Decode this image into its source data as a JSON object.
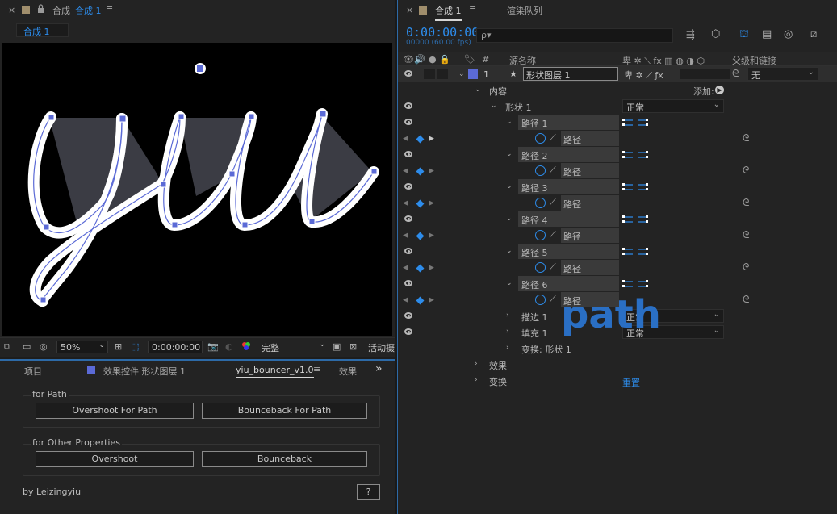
{
  "comp_panel": {
    "close": "×",
    "lock_icon": "lock-icon",
    "title_prefix": "合成",
    "title": "合成 1",
    "menu": "≡",
    "subtab": "合成 1",
    "viewer_text": "yiu",
    "toolbar": {
      "zoom": "50%",
      "timecode": "0:00:00:00",
      "quality": "完整",
      "active_camera": "活动摄"
    }
  },
  "fx_panel": {
    "tabs": [
      "项目",
      "效果控件 形状图层 1",
      "yiu_bouncer_v1.0",
      "效果"
    ],
    "menu": "≡",
    "more": "»",
    "group1_title": "for Path",
    "btn_overshoot_path": "Overshoot For Path",
    "btn_bounceback_path": "Bounceback For Path",
    "group2_title": "for Other Properties",
    "btn_overshoot": "Overshoot",
    "btn_bounceback": "Bounceback",
    "author": "by Leizingyiu",
    "help": "?"
  },
  "timeline": {
    "tab_comp": "合成 1",
    "tab_render": "渲染队列",
    "menu": "≡",
    "timecode": "0:00:00:00",
    "fps": "00000 (60.00 fps)",
    "search_placeholder": "ρ▾",
    "headers": {
      "num": "#",
      "source_name": "源名称",
      "parent": "父级和链接",
      "fx": "fx"
    },
    "layer": {
      "num": "1",
      "star": "★",
      "name": "形状图层 1",
      "parent": "无"
    },
    "contents_label": "内容",
    "add_label": "添加:",
    "shape1_label": "形状 1",
    "blend_mode": "正常",
    "paths": [
      {
        "name": "路径 1",
        "prop": "路径"
      },
      {
        "name": "路径 2",
        "prop": "路径"
      },
      {
        "name": "路径 3",
        "prop": "路径"
      },
      {
        "name": "路径 4",
        "prop": "路径"
      },
      {
        "name": "路径 5",
        "prop": "路径"
      },
      {
        "name": "路径 6",
        "prop": "路径"
      }
    ],
    "stroke_label": "描边 1",
    "fill_label": "填充 1",
    "stroke_mode": "正常",
    "fill_mode": "正常",
    "transform_shape_label": "变换: 形状 1",
    "effects_label": "效果",
    "transform_label": "变换",
    "reset_label": "重置",
    "overlay_text": "path"
  },
  "colors": {
    "accent": "#2d8ceb",
    "layer_label": "#5b6ad6",
    "panel_bg": "#232323"
  }
}
